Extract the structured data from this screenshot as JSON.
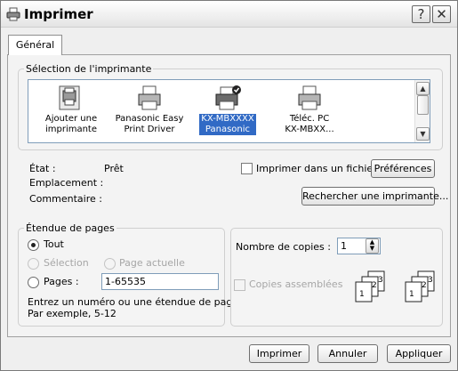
{
  "window": {
    "title": "Imprimer",
    "help_label": "?",
    "close_label": "✕"
  },
  "tabs": [
    {
      "label": "Général"
    }
  ],
  "printer_selection": {
    "legend": "Sélection de l'imprimante",
    "printers": [
      {
        "line1": "Ajouter une",
        "line2": "imprimante",
        "icon": "add-printer-icon"
      },
      {
        "line1": "Panasonic Easy",
        "line2": "Print Driver",
        "icon": "printer-icon"
      },
      {
        "line1": "KX-MBXXXX",
        "line2": "Panasonic",
        "icon": "default-printer-icon",
        "selected": true
      },
      {
        "line1": "Téléc. PC",
        "line2": "KX-MBXX...",
        "icon": "fax-printer-icon"
      }
    ],
    "state_label": "État :",
    "state_value": "Prêt",
    "location_label": "Emplacement :",
    "comment_label": "Commentaire :",
    "print_to_file_label": "Imprimer dans un fichier",
    "print_to_file_checked": false,
    "preferences_button": "Préférences",
    "find_printer_button": "Rechercher une imprimante..."
  },
  "page_range": {
    "legend": "Étendue de pages",
    "all_label": "Tout",
    "selection_label": "Sélection",
    "current_page_label": "Page actuelle",
    "pages_label": "Pages :",
    "pages_value": "1-65535",
    "hint_line1": "Entrez un numéro ou une étendue de pages.",
    "hint_line2": "Par exemple, 5-12",
    "selected": "all"
  },
  "copies": {
    "label": "Nombre de copies :",
    "value": "1",
    "collate_label": "Copies assemblées",
    "collate_checked": false,
    "collate_icon_numbers": [
      "1",
      "2",
      "3",
      "1",
      "2",
      "3"
    ]
  },
  "footer": {
    "print_button": "Imprimer",
    "cancel_button": "Annuler",
    "apply_button": "Appliquer"
  },
  "colors": {
    "selection": "#316ac5",
    "window_bg": "#efefef"
  }
}
